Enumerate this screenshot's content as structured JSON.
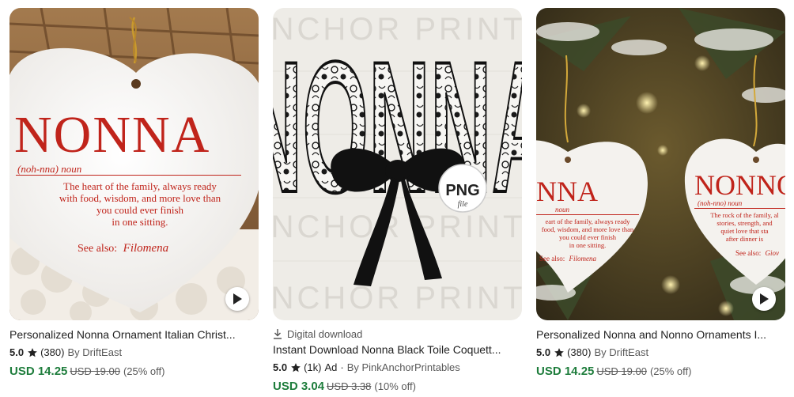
{
  "listings": [
    {
      "title": "Personalized Nonna Ornament Italian Christ...",
      "rating": "5.0",
      "reviews": "(380)",
      "shop": "By DriftEast",
      "price": "USD 14.25",
      "original_price": "USD 19.00",
      "discount": "(25% off)",
      "has_video": true,
      "image_text": {
        "headline": "NONNA",
        "pron": "(noh-nna) noun",
        "line1": "The heart of the family, always ready",
        "line2": "with food, wisdom, and more love than",
        "line3": "you could ever finish",
        "line4": "in one sitting.",
        "see_also": "See also:",
        "see_name": "Filomena"
      }
    },
    {
      "badge": "Digital download",
      "title": "Instant Download Nonna Black Toile Coquett...",
      "rating": "5.0",
      "reviews": "(1k)",
      "ad": "Ad",
      "separator": "·",
      "shop": "By PinkAnchorPrintables",
      "price": "USD 3.04",
      "original_price": "USD 3.38",
      "discount": "(10% off)",
      "image_text": {
        "headline": "NONNA",
        "png": "PNG",
        "file": "file",
        "watermark": "ANCHOR PRINTA"
      }
    },
    {
      "title": "Personalized Nonna and Nonno Ornaments I...",
      "rating": "5.0",
      "reviews": "(380)",
      "shop": "By DriftEast",
      "price": "USD 14.25",
      "original_price": "USD 19.00",
      "discount": "(25% off)",
      "has_video": true,
      "image_text": {
        "left_headline": "NNA",
        "left_pron": "noun",
        "left_line1": "eart of the family, always ready",
        "left_line2": "food, wisdom, and more love than",
        "left_line3": "you could ever finish",
        "left_line4": "in one sitting.",
        "left_see": "See also:",
        "left_name": "Filomena",
        "right_headline": "NONNO",
        "right_pron": "(noh-nno) noun",
        "right_line1": "The rock of the family, al",
        "right_line2": "stories, strength, and",
        "right_line3": "quiet love that sta",
        "right_line4": "after dinner is",
        "right_see": "See also:",
        "right_name": "Giov"
      }
    }
  ],
  "icons": {
    "play": "play-icon",
    "star": "star-icon",
    "download": "download-icon"
  },
  "colors": {
    "price_green": "#1e7d3c",
    "ornament_red": "#c0241b"
  }
}
